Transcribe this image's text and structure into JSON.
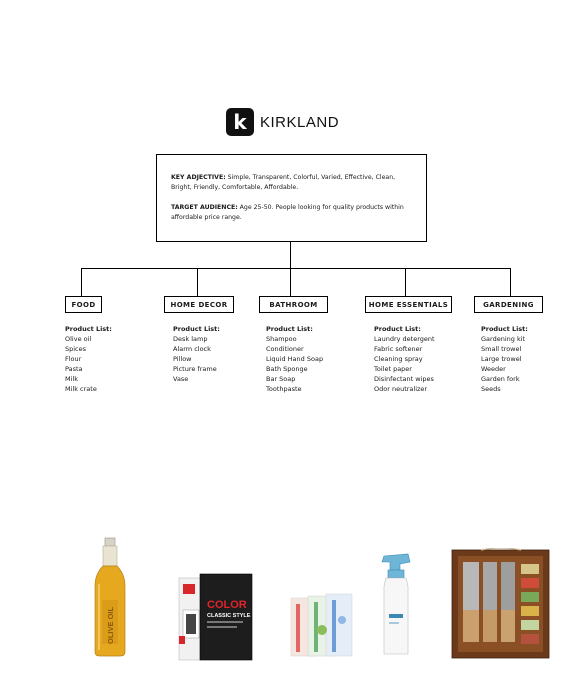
{
  "brand": {
    "logo_letter": "k",
    "name": "KIRKLAND"
  },
  "brief": {
    "adjective_label": "KEY ADJECTIVE:",
    "adjective_text": " Simple, Transparent, Colorful, Varied, Effective, Clean, Bright, Friendly, Comfortable, Affordable.",
    "audience_label": "TARGET AUDIENCE:",
    "audience_text": " Age 25-50. People looking for quality products within affordable price range."
  },
  "product_list_label": "Product List:",
  "categories": [
    {
      "name": "FOOD",
      "items": [
        "Olive oil",
        "Spices",
        "Flour",
        "Pasta",
        "Milk",
        "Milk crate"
      ]
    },
    {
      "name": "HOME DECOR",
      "items": [
        "Desk lamp",
        "Alarm clock",
        "Pillow",
        "Picture frame",
        "Vase"
      ]
    },
    {
      "name": "BATHROOM",
      "items": [
        "Shampoo",
        "Conditioner",
        "Liquid Hand Soap",
        "Bath Sponge",
        "Bar Soap",
        "Toothpaste"
      ]
    },
    {
      "name": "HOME ESSENTIALS",
      "items": [
        "Laundry detergent",
        "Fabric softener",
        "Cleaning spray",
        "Toilet paper",
        "Disinfectant wipes",
        "Odor neutralizer"
      ]
    },
    {
      "name": "GARDENING",
      "items": [
        "Gardening kit",
        "Small trowel",
        "Large trowel",
        "Weeder",
        "Garden fork",
        "Seeds"
      ]
    }
  ],
  "product_images": {
    "olive_oil_label": "OLIVE OIL",
    "frame_box_label": "COLOR",
    "frame_box_tagline": "CLASSIC STYLE"
  }
}
